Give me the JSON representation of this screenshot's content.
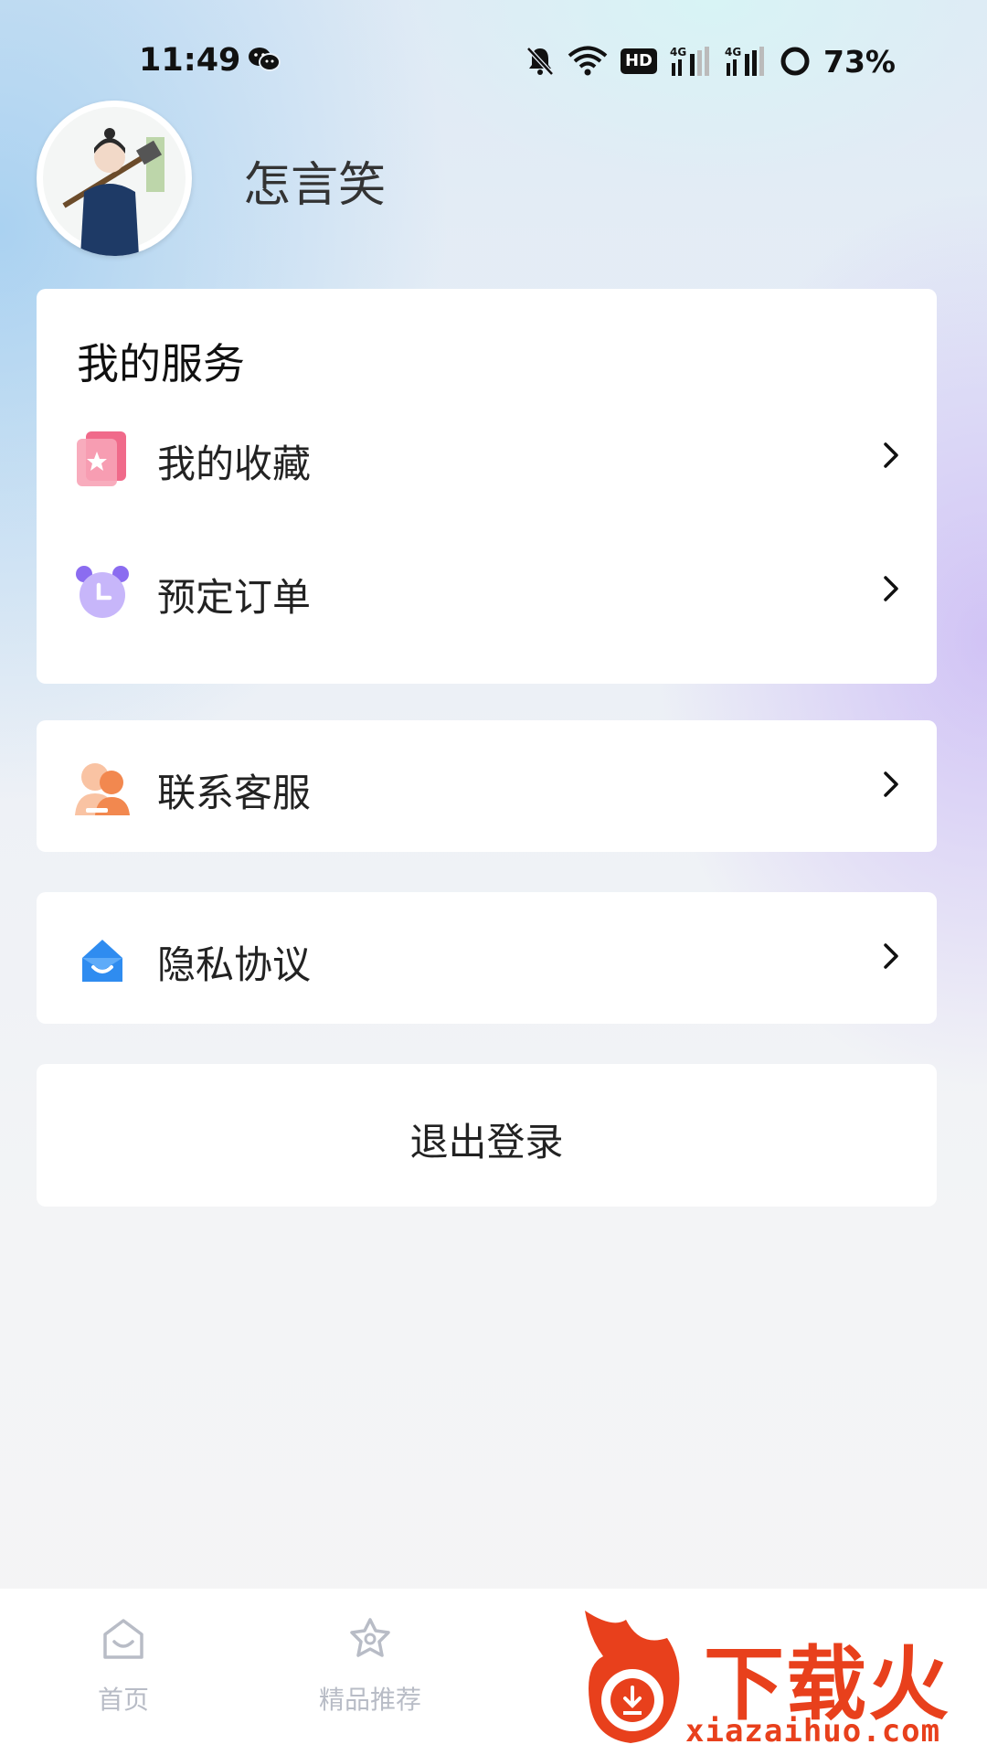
{
  "status_bar": {
    "time": "11:49",
    "battery": "73%",
    "hd_label": "HD"
  },
  "profile": {
    "username": "怎言笑"
  },
  "services": {
    "title": "我的服务",
    "items": [
      {
        "label": "我的收藏",
        "icon": "favorites-icon"
      },
      {
        "label": "预定订单",
        "icon": "alarm-clock-icon"
      }
    ]
  },
  "contact": {
    "label": "联系客服",
    "icon": "customer-service-icon"
  },
  "privacy": {
    "label": "隐私协议",
    "icon": "privacy-icon"
  },
  "logout": {
    "label": "退出登录"
  },
  "tabbar": {
    "tabs": [
      {
        "label": "首页",
        "icon": "home-icon"
      },
      {
        "label": "精品推荐",
        "icon": "flower-star-icon"
      }
    ]
  },
  "watermark": {
    "brand": "下载火",
    "url": "xiazaihuo.com"
  },
  "colors": {
    "accent_red": "#e8401c",
    "favorites_pink": "#f06a8a",
    "clock_purple": "#a78bf5",
    "service_orange": "#f2884f",
    "privacy_blue": "#2f8cf0"
  }
}
